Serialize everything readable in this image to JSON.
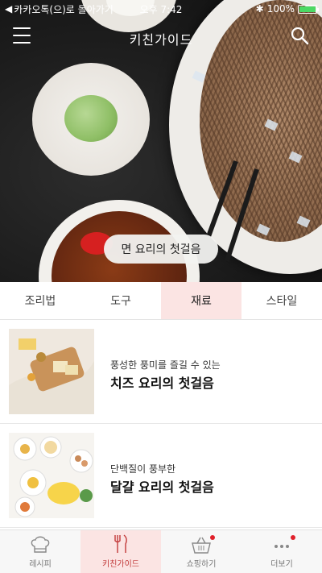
{
  "status_bar": {
    "back_label": "카카오톡(으)로 돌아가기",
    "time": "오후 7:42",
    "battery": "100%",
    "battery_level": 1.0
  },
  "app_bar": {
    "title": "키친가이드",
    "menu_icon": "hamburger-menu-icon",
    "search_icon": "search-icon"
  },
  "hero": {
    "pill_label": "면 요리의 첫걸음"
  },
  "tabs": [
    {
      "label": "조리법",
      "active": false
    },
    {
      "label": "도구",
      "active": false
    },
    {
      "label": "재료",
      "active": true
    },
    {
      "label": "스타일",
      "active": false
    }
  ],
  "cards": [
    {
      "subtitle": "풍성한 풍미를 즐길 수 있는",
      "title": "치즈 요리의 첫걸음"
    },
    {
      "subtitle": "단백질이 풍부한",
      "title": "달걀 요리의 첫걸음"
    }
  ],
  "bottom_nav": [
    {
      "label": "레시피",
      "icon": "chef-hat-icon",
      "active": false,
      "badge": false
    },
    {
      "label": "키친가이드",
      "icon": "kitchen-tools-icon",
      "active": true,
      "badge": false
    },
    {
      "label": "쇼핑하기",
      "icon": "shopping-basket-icon",
      "active": false,
      "badge": true
    },
    {
      "label": "더보기",
      "icon": "more-dots-icon",
      "active": false,
      "badge": true
    }
  ],
  "colors": {
    "accent_pink": "#fbe4e3",
    "badge_red": "#e0202a",
    "battery_green": "#4cd964"
  }
}
